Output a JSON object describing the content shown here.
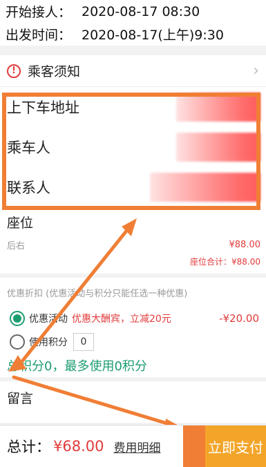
{
  "header": {
    "start_label": "开始接人：",
    "start_value": "2020-08-17 08:30",
    "depart_label": "出发时间：",
    "depart_value": "2020-08-17(上午)9:30"
  },
  "notice": {
    "label": "乘客须知",
    "icon": "exclamation-icon",
    "chevron": "›"
  },
  "details": {
    "address_label": "上下车地址",
    "passenger_label": "乘车人",
    "contact_label": "联系人"
  },
  "seat": {
    "title": "座位",
    "row_name": "后右",
    "row_price": "¥88.00",
    "total": "座位合计：¥88.00"
  },
  "discount": {
    "title": "优惠折扣 (优惠活动与积分只能任选一种优惠)",
    "activity_label": "优惠活动",
    "activity_desc": "优惠大酬宾，立减20元",
    "activity_amount": "-¥20.00",
    "points_label": "使用积分",
    "points_value": "0",
    "points_info": "总积分0，最多使用0积分"
  },
  "message": {
    "title": "留言"
  },
  "footer": {
    "total_label": "总计：",
    "total_amount": "¥68.00",
    "detail_link": "费用明细",
    "pay_button": "立即支付"
  },
  "colors": {
    "accent_green": "#1c9d6f",
    "price_red": "#e23a3a",
    "annotation_orange": "#f07e35",
    "pay_yellow": "#f3a52a"
  }
}
